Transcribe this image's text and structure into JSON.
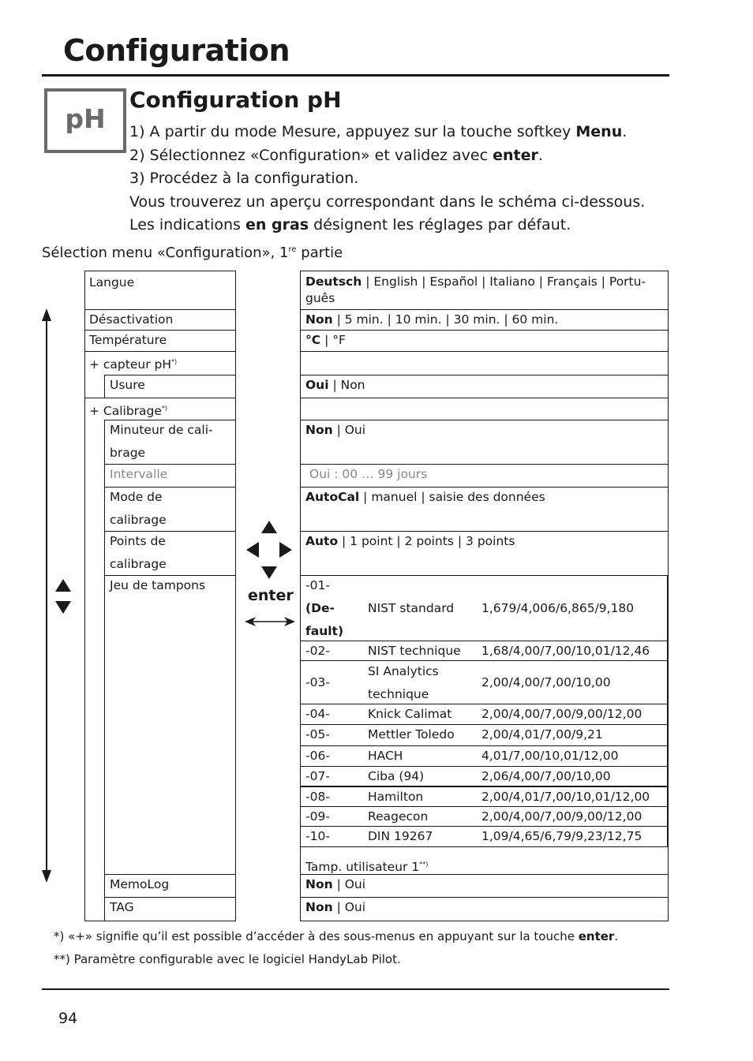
{
  "page": {
    "title": "Configuration",
    "badge": "pH",
    "section_title": "Configuration pH",
    "intro": [
      {
        "pre": "1) A partir du mode Mesure, appuyez sur la touche softkey ",
        "bold": "Menu",
        "post": "."
      },
      {
        "pre": "2) Sélectionnez «Configuration» et validez avec ",
        "bold": "enter",
        "post": "."
      },
      {
        "pre": "3) Procédez à la configuration.",
        "bold": "",
        "post": ""
      },
      {
        "pre": "Vous trouverez un aperçu correspondant dans le schéma ci-dessous.",
        "bold": "",
        "post": ""
      },
      {
        "pre": "Les indications ",
        "bold": "en gras",
        "post": " désignent les réglages par défaut."
      }
    ],
    "caption": {
      "pre": "Sélection menu «Configuration», 1",
      "sup": "re",
      "post": " partie"
    },
    "page_number": "94"
  },
  "menu": {
    "items": [
      {
        "label": "Langue",
        "sup": ""
      },
      {
        "label": "Désactivation",
        "sup": ""
      },
      {
        "label": "Température",
        "sup": ""
      },
      {
        "label": "+ capteur pH",
        "sup": "*)"
      },
      {
        "label": "Usure",
        "sup": ""
      },
      {
        "label": "+ Calibrage",
        "sup": "*)"
      },
      {
        "label": "Minuteur de cali-",
        "label2": "brage"
      },
      {
        "label": "Intervalle"
      },
      {
        "label": "Mode de",
        "label2": "calibrage"
      },
      {
        "label": "Points de",
        "label2": "calibrage"
      },
      {
        "label": "Jeu de tampons"
      },
      {
        "label": "MemoLog"
      },
      {
        "label": "TAG"
      }
    ]
  },
  "options": {
    "langue": {
      "bold": "Deutsch",
      "rest": " | English | Español | Italiano | Français | Portu-",
      "line2": "guês"
    },
    "desactivation": {
      "bold": "Non",
      "rest": " | 5 min. | 10 min. | 30 min. | 60 min."
    },
    "temperature": {
      "bold": "°C",
      "rest": "  | °F"
    },
    "usure": {
      "bold": "Oui",
      "rest": " | Non"
    },
    "minuteur": {
      "bold": "Non",
      "rest": " | Oui"
    },
    "intervalle": {
      "text": "Oui : 00 … 99 jours"
    },
    "mode": {
      "bold": "AutoCal",
      "rest": " | manuel | saisie des données"
    },
    "points": {
      "bold": "Auto",
      "rest": " | 1 point | 2 points | 3 points"
    },
    "memolog": {
      "bold": "Non",
      "rest": " | Oui"
    },
    "tag": {
      "bold": "Non",
      "rest": " | Oui"
    }
  },
  "buffers": {
    "default": {
      "code": "-01-",
      "default_l1": "(De-",
      "default_l2": "fault)",
      "name": "NIST standard",
      "values": "1,679/4,006/6,865/9,180"
    },
    "rows": [
      {
        "code": "-02-",
        "name": "NIST technique",
        "values": "1,68/4,00/7,00/10,01/12,46"
      },
      {
        "code": "-03-",
        "name": "SI Analytics",
        "name2": "technique",
        "values": "2,00/4,00/7,00/10,00"
      },
      {
        "code": "-04-",
        "name": "Knick Calimat",
        "values": "2,00/4,00/7,00/9,00/12,00"
      },
      {
        "code": "-05-",
        "name": "Mettler Toledo",
        "values": "2,00/4,01/7,00/9,21"
      },
      {
        "code": "-06-",
        "name": "HACH",
        "values": "4,01/7,00/10,01/12,00"
      },
      {
        "code": "-07-",
        "name": "Ciba (94)",
        "values": "2,06/4,00/7,00/10,00"
      },
      {
        "code": "-08-",
        "name": "Hamilton",
        "values": "2,00/4,01/7,00/10,01/12,00"
      },
      {
        "code": "-09-",
        "name": "Reagecon",
        "values": "2,00/4,00/7,00/9,00/12,00"
      },
      {
        "code": "-10-",
        "name": "DIN 19267",
        "values": "1,09/4,65/6,79/9,23/12,75"
      }
    ],
    "user": {
      "label": "Tamp. utilisateur 1",
      "sup": "**)"
    }
  },
  "keys": {
    "enter_label": "enter",
    "icons": [
      "arrow-up-icon",
      "arrow-left-icon",
      "arrow-right-icon",
      "arrow-down-icon",
      "double-arrow-icon",
      "scroll-up-icon",
      "scroll-down-icon"
    ]
  },
  "footnotes": {
    "f1": {
      "pre": "*)  «+» signifie qu’il est possible d’accéder à des sous-menus en appuyant sur la touche ",
      "bold": "enter",
      "post": "."
    },
    "f2": {
      "text": "**) Paramètre configurable avec le logiciel HandyLab Pilot."
    }
  }
}
